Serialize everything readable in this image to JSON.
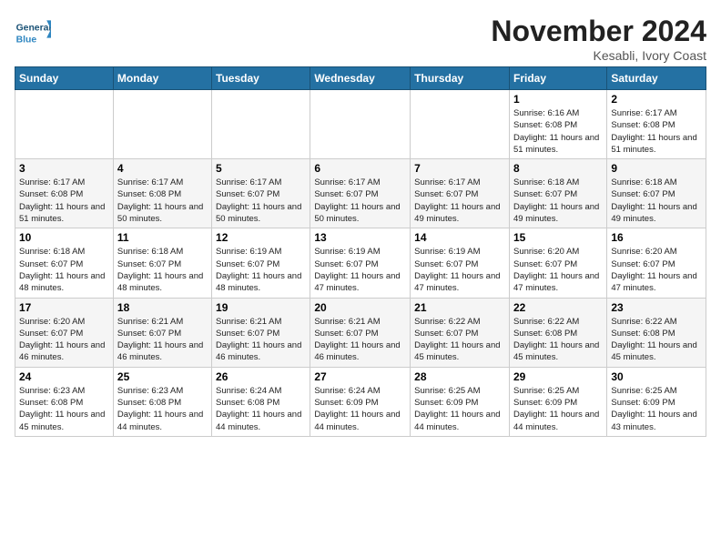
{
  "logo": {
    "general": "General",
    "blue": "Blue"
  },
  "title": "November 2024",
  "location": "Kesabli, Ivory Coast",
  "days_of_week": [
    "Sunday",
    "Monday",
    "Tuesday",
    "Wednesday",
    "Thursday",
    "Friday",
    "Saturday"
  ],
  "weeks": [
    [
      {
        "day": "",
        "sunrise": "",
        "sunset": "",
        "daylight": ""
      },
      {
        "day": "",
        "sunrise": "",
        "sunset": "",
        "daylight": ""
      },
      {
        "day": "",
        "sunrise": "",
        "sunset": "",
        "daylight": ""
      },
      {
        "day": "",
        "sunrise": "",
        "sunset": "",
        "daylight": ""
      },
      {
        "day": "",
        "sunrise": "",
        "sunset": "",
        "daylight": ""
      },
      {
        "day": "1",
        "sunrise": "Sunrise: 6:16 AM",
        "sunset": "Sunset: 6:08 PM",
        "daylight": "Daylight: 11 hours and 51 minutes."
      },
      {
        "day": "2",
        "sunrise": "Sunrise: 6:17 AM",
        "sunset": "Sunset: 6:08 PM",
        "daylight": "Daylight: 11 hours and 51 minutes."
      }
    ],
    [
      {
        "day": "3",
        "sunrise": "Sunrise: 6:17 AM",
        "sunset": "Sunset: 6:08 PM",
        "daylight": "Daylight: 11 hours and 51 minutes."
      },
      {
        "day": "4",
        "sunrise": "Sunrise: 6:17 AM",
        "sunset": "Sunset: 6:08 PM",
        "daylight": "Daylight: 11 hours and 50 minutes."
      },
      {
        "day": "5",
        "sunrise": "Sunrise: 6:17 AM",
        "sunset": "Sunset: 6:07 PM",
        "daylight": "Daylight: 11 hours and 50 minutes."
      },
      {
        "day": "6",
        "sunrise": "Sunrise: 6:17 AM",
        "sunset": "Sunset: 6:07 PM",
        "daylight": "Daylight: 11 hours and 50 minutes."
      },
      {
        "day": "7",
        "sunrise": "Sunrise: 6:17 AM",
        "sunset": "Sunset: 6:07 PM",
        "daylight": "Daylight: 11 hours and 49 minutes."
      },
      {
        "day": "8",
        "sunrise": "Sunrise: 6:18 AM",
        "sunset": "Sunset: 6:07 PM",
        "daylight": "Daylight: 11 hours and 49 minutes."
      },
      {
        "day": "9",
        "sunrise": "Sunrise: 6:18 AM",
        "sunset": "Sunset: 6:07 PM",
        "daylight": "Daylight: 11 hours and 49 minutes."
      }
    ],
    [
      {
        "day": "10",
        "sunrise": "Sunrise: 6:18 AM",
        "sunset": "Sunset: 6:07 PM",
        "daylight": "Daylight: 11 hours and 48 minutes."
      },
      {
        "day": "11",
        "sunrise": "Sunrise: 6:18 AM",
        "sunset": "Sunset: 6:07 PM",
        "daylight": "Daylight: 11 hours and 48 minutes."
      },
      {
        "day": "12",
        "sunrise": "Sunrise: 6:19 AM",
        "sunset": "Sunset: 6:07 PM",
        "daylight": "Daylight: 11 hours and 48 minutes."
      },
      {
        "day": "13",
        "sunrise": "Sunrise: 6:19 AM",
        "sunset": "Sunset: 6:07 PM",
        "daylight": "Daylight: 11 hours and 47 minutes."
      },
      {
        "day": "14",
        "sunrise": "Sunrise: 6:19 AM",
        "sunset": "Sunset: 6:07 PM",
        "daylight": "Daylight: 11 hours and 47 minutes."
      },
      {
        "day": "15",
        "sunrise": "Sunrise: 6:20 AM",
        "sunset": "Sunset: 6:07 PM",
        "daylight": "Daylight: 11 hours and 47 minutes."
      },
      {
        "day": "16",
        "sunrise": "Sunrise: 6:20 AM",
        "sunset": "Sunset: 6:07 PM",
        "daylight": "Daylight: 11 hours and 47 minutes."
      }
    ],
    [
      {
        "day": "17",
        "sunrise": "Sunrise: 6:20 AM",
        "sunset": "Sunset: 6:07 PM",
        "daylight": "Daylight: 11 hours and 46 minutes."
      },
      {
        "day": "18",
        "sunrise": "Sunrise: 6:21 AM",
        "sunset": "Sunset: 6:07 PM",
        "daylight": "Daylight: 11 hours and 46 minutes."
      },
      {
        "day": "19",
        "sunrise": "Sunrise: 6:21 AM",
        "sunset": "Sunset: 6:07 PM",
        "daylight": "Daylight: 11 hours and 46 minutes."
      },
      {
        "day": "20",
        "sunrise": "Sunrise: 6:21 AM",
        "sunset": "Sunset: 6:07 PM",
        "daylight": "Daylight: 11 hours and 46 minutes."
      },
      {
        "day": "21",
        "sunrise": "Sunrise: 6:22 AM",
        "sunset": "Sunset: 6:07 PM",
        "daylight": "Daylight: 11 hours and 45 minutes."
      },
      {
        "day": "22",
        "sunrise": "Sunrise: 6:22 AM",
        "sunset": "Sunset: 6:08 PM",
        "daylight": "Daylight: 11 hours and 45 minutes."
      },
      {
        "day": "23",
        "sunrise": "Sunrise: 6:22 AM",
        "sunset": "Sunset: 6:08 PM",
        "daylight": "Daylight: 11 hours and 45 minutes."
      }
    ],
    [
      {
        "day": "24",
        "sunrise": "Sunrise: 6:23 AM",
        "sunset": "Sunset: 6:08 PM",
        "daylight": "Daylight: 11 hours and 45 minutes."
      },
      {
        "day": "25",
        "sunrise": "Sunrise: 6:23 AM",
        "sunset": "Sunset: 6:08 PM",
        "daylight": "Daylight: 11 hours and 44 minutes."
      },
      {
        "day": "26",
        "sunrise": "Sunrise: 6:24 AM",
        "sunset": "Sunset: 6:08 PM",
        "daylight": "Daylight: 11 hours and 44 minutes."
      },
      {
        "day": "27",
        "sunrise": "Sunrise: 6:24 AM",
        "sunset": "Sunset: 6:09 PM",
        "daylight": "Daylight: 11 hours and 44 minutes."
      },
      {
        "day": "28",
        "sunrise": "Sunrise: 6:25 AM",
        "sunset": "Sunset: 6:09 PM",
        "daylight": "Daylight: 11 hours and 44 minutes."
      },
      {
        "day": "29",
        "sunrise": "Sunrise: 6:25 AM",
        "sunset": "Sunset: 6:09 PM",
        "daylight": "Daylight: 11 hours and 44 minutes."
      },
      {
        "day": "30",
        "sunrise": "Sunrise: 6:25 AM",
        "sunset": "Sunset: 6:09 PM",
        "daylight": "Daylight: 11 hours and 43 minutes."
      }
    ]
  ]
}
